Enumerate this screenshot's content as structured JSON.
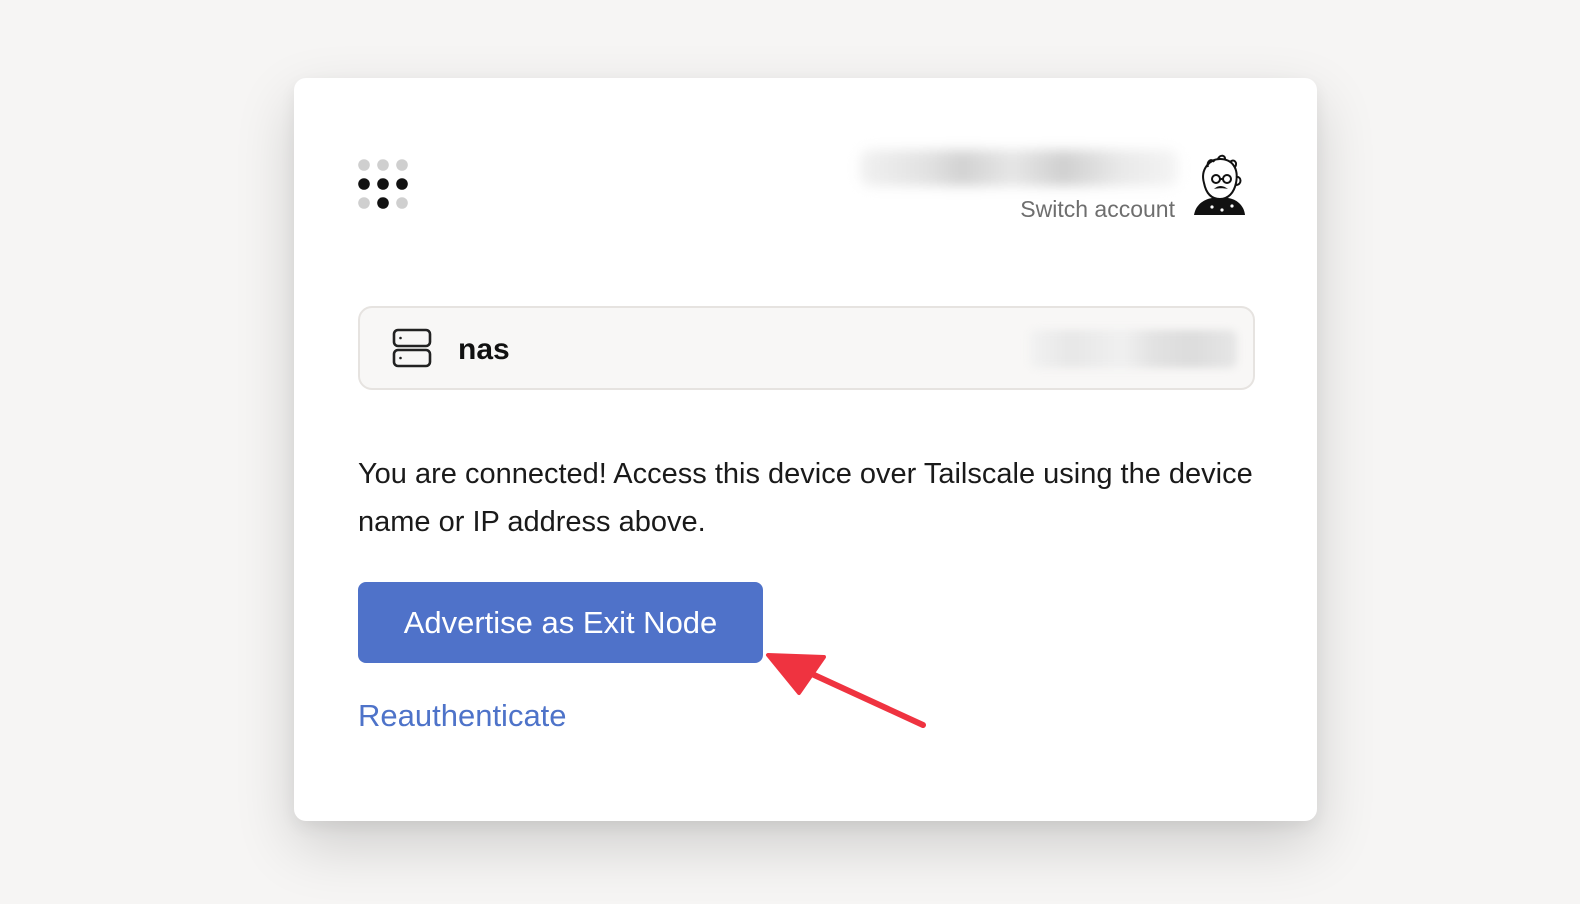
{
  "header": {
    "account_switch_label": "Switch account"
  },
  "device": {
    "name": "nas",
    "icon": "server-icon"
  },
  "main": {
    "message": "You are connected! Access this device over Tailscale using the device name or IP address above.",
    "primary_button_label": "Advertise as Exit Node",
    "secondary_link_label": "Reauthenticate"
  },
  "colors": {
    "primary": "#4f72c9",
    "link": "#4e73c9",
    "annotation_arrow": "#ef3340",
    "background": "#f6f5f4"
  }
}
